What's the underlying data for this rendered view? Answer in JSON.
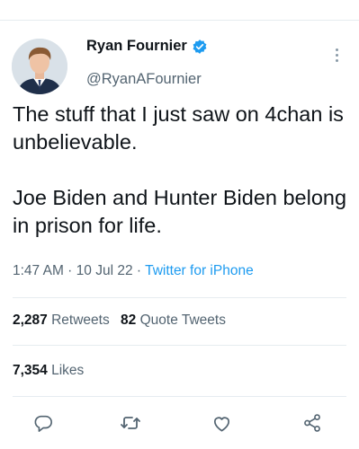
{
  "tweet": {
    "display_name": "Ryan Fournier",
    "handle": "@RyanAFournier",
    "verified": true,
    "text": "The stuff that I just saw on 4chan is unbelievable.\n\nJoe Biden and Hunter Biden belong in prison for life.",
    "time": "1:47 AM",
    "date": "10 Jul 22",
    "source": "Twitter for iPhone",
    "separator": " · "
  },
  "stats": {
    "retweets_count": "2,287",
    "retweets_label": "Retweets",
    "quotes_count": "82",
    "quotes_label": "Quote Tweets",
    "likes_count": "7,354",
    "likes_label": "Likes"
  },
  "icons": {
    "reply": "reply-icon",
    "retweet": "retweet-icon",
    "like": "like-icon",
    "share": "share-icon",
    "verified": "verified-badge-icon",
    "more": "more-icon"
  },
  "colors": {
    "accent": "#1d9bf0",
    "text": "#0f1419",
    "secondary": "#536471",
    "divider": "#e6ecf0"
  }
}
